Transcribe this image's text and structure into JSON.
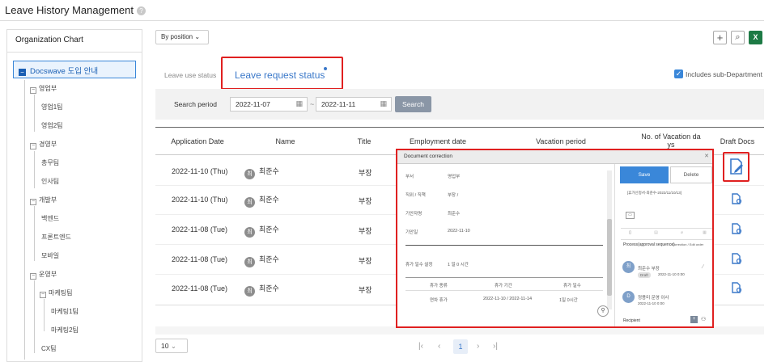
{
  "page": {
    "title": "Leave History Management",
    "help_icon": "question-circle-icon"
  },
  "org": {
    "title": "Organization Chart",
    "root": "Docswave 도입 안내",
    "nodes": [
      "영업부",
      "영업1팀",
      "영업2팀",
      "경영부",
      "총무팀",
      "인사팀",
      "개발부",
      "백엔드",
      "프론트엔드",
      "모바일",
      "운영부",
      "마케팅팀",
      "마케팅1팀",
      "마케팅2팀",
      "CX팀"
    ]
  },
  "toolbar": {
    "by_position": "By position",
    "add_icon": "plus-icon",
    "search_icon": "search-icon",
    "excel_icon": "excel-icon"
  },
  "tabs": {
    "use_status": "Leave use status",
    "request_status": "Leave request status"
  },
  "includes_sub": "Includes sub-Department",
  "search": {
    "period_label": "Search period",
    "from": "2022-11-07",
    "to": "2022-11-11",
    "button": "Search",
    "separator": "~"
  },
  "table": {
    "headers": {
      "application_date": "Application Date",
      "name": "Name",
      "title": "Title",
      "employment_date": "Employment date",
      "vacation_period": "Vacation period",
      "num_days_1": "No. of Vacation da",
      "num_days_2": "ys",
      "draft_docs": "Draft Docs"
    },
    "rows": [
      {
        "date": "2022-11-10 (Thu)",
        "avatar": "최",
        "name": "최준수",
        "title": "부장"
      },
      {
        "date": "2022-11-10 (Thu)",
        "avatar": "최",
        "name": "최준수",
        "title": "부장"
      },
      {
        "date": "2022-11-08 (Tue)",
        "avatar": "최",
        "name": "최준수",
        "title": "부장"
      },
      {
        "date": "2022-11-08 (Tue)",
        "avatar": "최",
        "name": "최준수",
        "title": "부장"
      },
      {
        "date": "2022-11-08 (Tue)",
        "avatar": "최",
        "name": "최준수",
        "title": "부장"
      }
    ]
  },
  "pager": {
    "page_size": "10",
    "current": "1"
  },
  "popup": {
    "title": "Document correction",
    "save": "Save",
    "delete": "Delete",
    "fields": [
      {
        "label": "부서",
        "value": "영업부"
      },
      {
        "label": "직위 / 직책",
        "value": "부장 /"
      },
      {
        "label": "기안자명",
        "value": "최준수"
      },
      {
        "label": "기안일",
        "value": "2022-11-10"
      }
    ],
    "vacation_label": "휴가 일수 설정",
    "vacation_value": "1 일 0 시간",
    "mini_headers": [
      "휴가 종류",
      "휴가 기간",
      "휴가 일수"
    ],
    "mini_row": [
      "연차 휴가",
      "2022-11-10 / 2022-11-14",
      "1일 0시간"
    ],
    "doc_title": "[휴가신청서-최준수-2022/11/10/13]",
    "process_label": "Process(approval sequence)",
    "process_note": "Correction / Edit order",
    "step1_title": "최준수 부장",
    "step1_badge": "Draft",
    "step1_date": "2022-11-10 0:00",
    "step2_title": "정용미 운영 이사",
    "step2_date": "2022-11-10 0:00",
    "recipient": "Recipient"
  }
}
